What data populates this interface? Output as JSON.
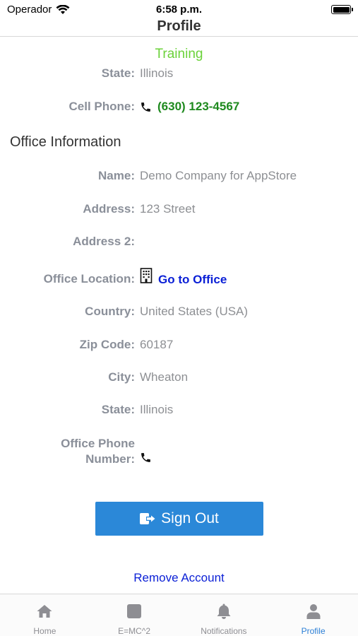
{
  "status_bar": {
    "carrier": "Operador",
    "time": "6:58 p.m."
  },
  "nav": {
    "title": "Profile"
  },
  "training_label": "Training",
  "personal": {
    "state_label": "State:",
    "state_value": "Illinois",
    "cell_phone_label": "Cell Phone:",
    "cell_phone_value": "(630) 123-4567"
  },
  "office": {
    "section_title": "Office Information",
    "name_label": "Name:",
    "name_value": "Demo Company for AppStore",
    "address_label": "Address:",
    "address_value": "123 Street",
    "address2_label": "Address 2:",
    "address2_value": "",
    "location_label": "Office Location:",
    "location_link": "Go to Office",
    "country_label": "Country:",
    "country_value": "United States (USA)",
    "zip_label": "Zip Code:",
    "zip_value": "60187",
    "city_label": "City:",
    "city_value": "Wheaton",
    "state_label": "State:",
    "state_value": "Illinois",
    "phone_label_line1": "Office Phone",
    "phone_label_line2": "Number:"
  },
  "actions": {
    "sign_out": "Sign Out",
    "remove_account": "Remove Account"
  },
  "tabs": [
    {
      "label": "Home",
      "icon": "home-icon"
    },
    {
      "label": "E=MC^2",
      "icon": "square-icon"
    },
    {
      "label": "Notifications",
      "icon": "bell-icon"
    },
    {
      "label": "Profile",
      "icon": "user-icon",
      "active": true
    }
  ],
  "colors": {
    "accent": "#2b88d8",
    "training": "#6bd23a",
    "phone_link": "#1f8a1f",
    "link": "#0a1fd6",
    "active_tab": "#2b7fd6"
  }
}
